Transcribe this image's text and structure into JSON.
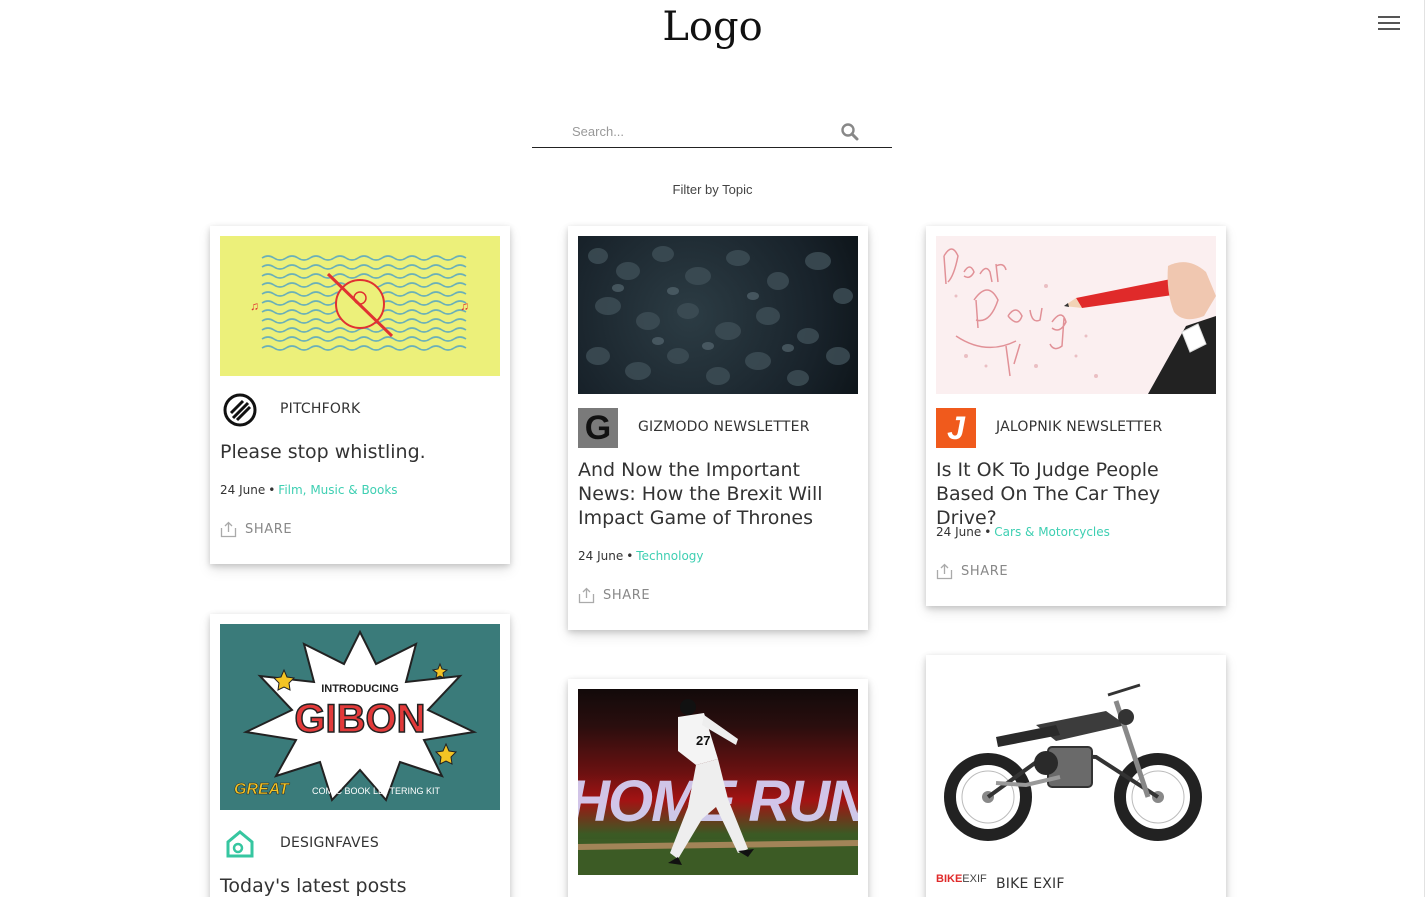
{
  "header": {
    "logo": "Logo",
    "menu_icon": "hamburger-menu-icon"
  },
  "search": {
    "placeholder": "Search...",
    "icon": "search-icon"
  },
  "filter": {
    "label": "Filter by Topic"
  },
  "accent_color": "#3ecfb2",
  "cards": [
    {
      "source": "PITCHFORK",
      "title": "Please stop whistling.",
      "date": "24 June",
      "topic": "Film, Music & Books",
      "share": "SHARE"
    },
    {
      "source": "GIZMODO NEWSLETTER",
      "title": "And Now the Important News: How the Brexit Will Impact Game of Thrones",
      "date": "24 June",
      "topic": "Technology",
      "share": "SHARE"
    },
    {
      "source": "JALOPNIK NEWSLETTER",
      "title": "Is It OK To Judge People Based On The Car They Drive?",
      "date": "24 June",
      "topic": "Cars & Motorcycles",
      "share": "SHARE"
    },
    {
      "source": "DESIGNFAVES",
      "title": "Today's latest posts",
      "image_text": {
        "intro": "INTRODUCING",
        "name": "GIBON",
        "great": "GREAT",
        "kit": "COMIC BOOK LETTERING KIT"
      }
    },
    {
      "source": "",
      "title": "",
      "image_text": {
        "banner": "HOME RUN",
        "jersey": "27"
      }
    },
    {
      "source": "BIKE EXIF",
      "logo_text": {
        "part1": "BIKE",
        "part2": "EXIF"
      }
    }
  ]
}
